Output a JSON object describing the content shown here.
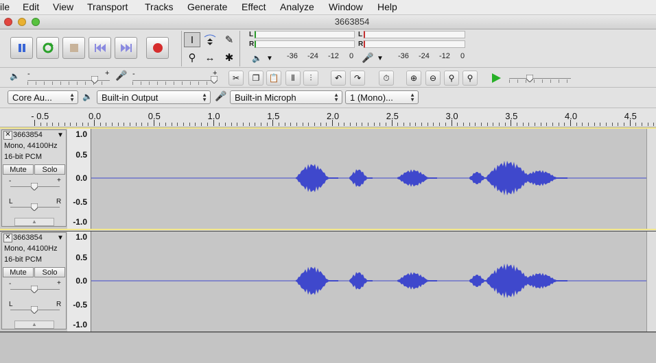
{
  "menu": [
    "ile",
    "Edit",
    "View",
    "Transport",
    "Tracks",
    "Generate",
    "Effect",
    "Analyze",
    "Window",
    "Help"
  ],
  "window": {
    "title": "3663854"
  },
  "colors": {
    "wave": "#3f48cc",
    "record": "#d62d2d",
    "play": "#27b027"
  },
  "meters": {
    "play": {
      "L": "L",
      "R": "R",
      "ticks": [
        "-36",
        "-24",
        "-12",
        "0"
      ]
    },
    "record": {
      "L": "L",
      "R": "R",
      "ticks": [
        "-36",
        "-24",
        "-12",
        "0"
      ]
    }
  },
  "sliders": {
    "gain_minus": "-",
    "gain_plus": "+"
  },
  "devices": {
    "host": "Core Au...",
    "output": "Built-in Output",
    "input": "Built-in Microph",
    "channels": "1 (Mono)..."
  },
  "ruler": {
    "labels": [
      "- 0.5",
      "0.0",
      "0.5",
      "1.0",
      "1.5",
      "2.0",
      "2.5",
      "3.0",
      "3.5",
      "4.0",
      "4.5"
    ]
  },
  "tracks": [
    {
      "name": "3663854",
      "rate": "Mono, 44100Hz",
      "format": "16-bit PCM",
      "mute": "Mute",
      "solo": "Solo",
      "gain_minus": "-",
      "gain_plus": "+",
      "pan_left": "L",
      "pan_right": "R",
      "scale": [
        "1.0",
        "0.5",
        "0.0",
        "-0.5",
        "-1.0"
      ]
    },
    {
      "name": "3663854",
      "rate": "Mono, 44100Hz",
      "format": "16-bit PCM",
      "mute": "Mute",
      "solo": "Solo",
      "gain_minus": "-",
      "gain_plus": "+",
      "pan_left": "L",
      "pan_right": "R",
      "scale": [
        "1.0",
        "0.5",
        "0.0",
        "-0.5",
        "-1.0"
      ]
    }
  ]
}
